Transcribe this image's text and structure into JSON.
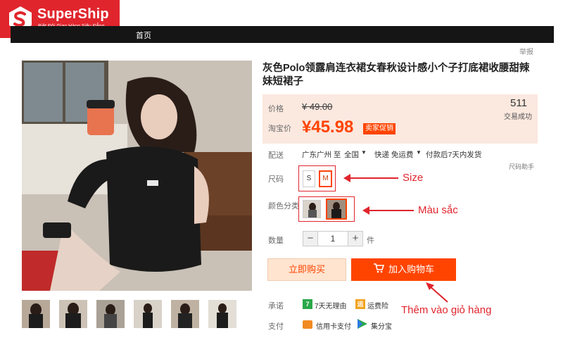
{
  "brand": {
    "name": "SuperShip",
    "tagline": "Biệt Đội Giao Hàng Siêu Đẳng",
    "color": "#e0252d"
  },
  "nav": {
    "home": "首页",
    "report": "举报"
  },
  "product": {
    "title": "灰色Polo领露肩连衣裙女春秋设计感小个子打底裙收腰甜辣妹短裙子",
    "price_label": "价格",
    "original_price": "¥ 49.00",
    "taobao_price_label": "淘宝价",
    "sale_price": "¥45.98",
    "promo_badge": "卖家促销",
    "sales_count": "511",
    "sales_label": "交易成功",
    "accent_color": "#ff4400"
  },
  "shipping": {
    "label": "配送",
    "from": "广东广州 至",
    "to": "全国",
    "express": "快递 免运费",
    "dispatch": "付款后7天内发货"
  },
  "size": {
    "label": "尺码",
    "helper": "尺码助手",
    "options": [
      "S",
      "M"
    ],
    "selected": "M"
  },
  "color": {
    "label": "颜色分类"
  },
  "quantity": {
    "label": "数量",
    "value": "1",
    "minus": "−",
    "plus": "+",
    "unit": "件"
  },
  "actions": {
    "buy_now": "立即购买",
    "add_to_cart": "加入购物车"
  },
  "promise": {
    "label": "承诺",
    "return_badge": "7",
    "return_text": "7天无理由",
    "insurance_badge": "运",
    "insurance_text": "运费险"
  },
  "payment": {
    "label": "支付",
    "credit_text": "信用卡支付",
    "split_text": "集分宝"
  },
  "annotations": {
    "size": "Size",
    "color": "Màu sắc",
    "add_to_cart": "Thêm vào giỏ hàng"
  }
}
